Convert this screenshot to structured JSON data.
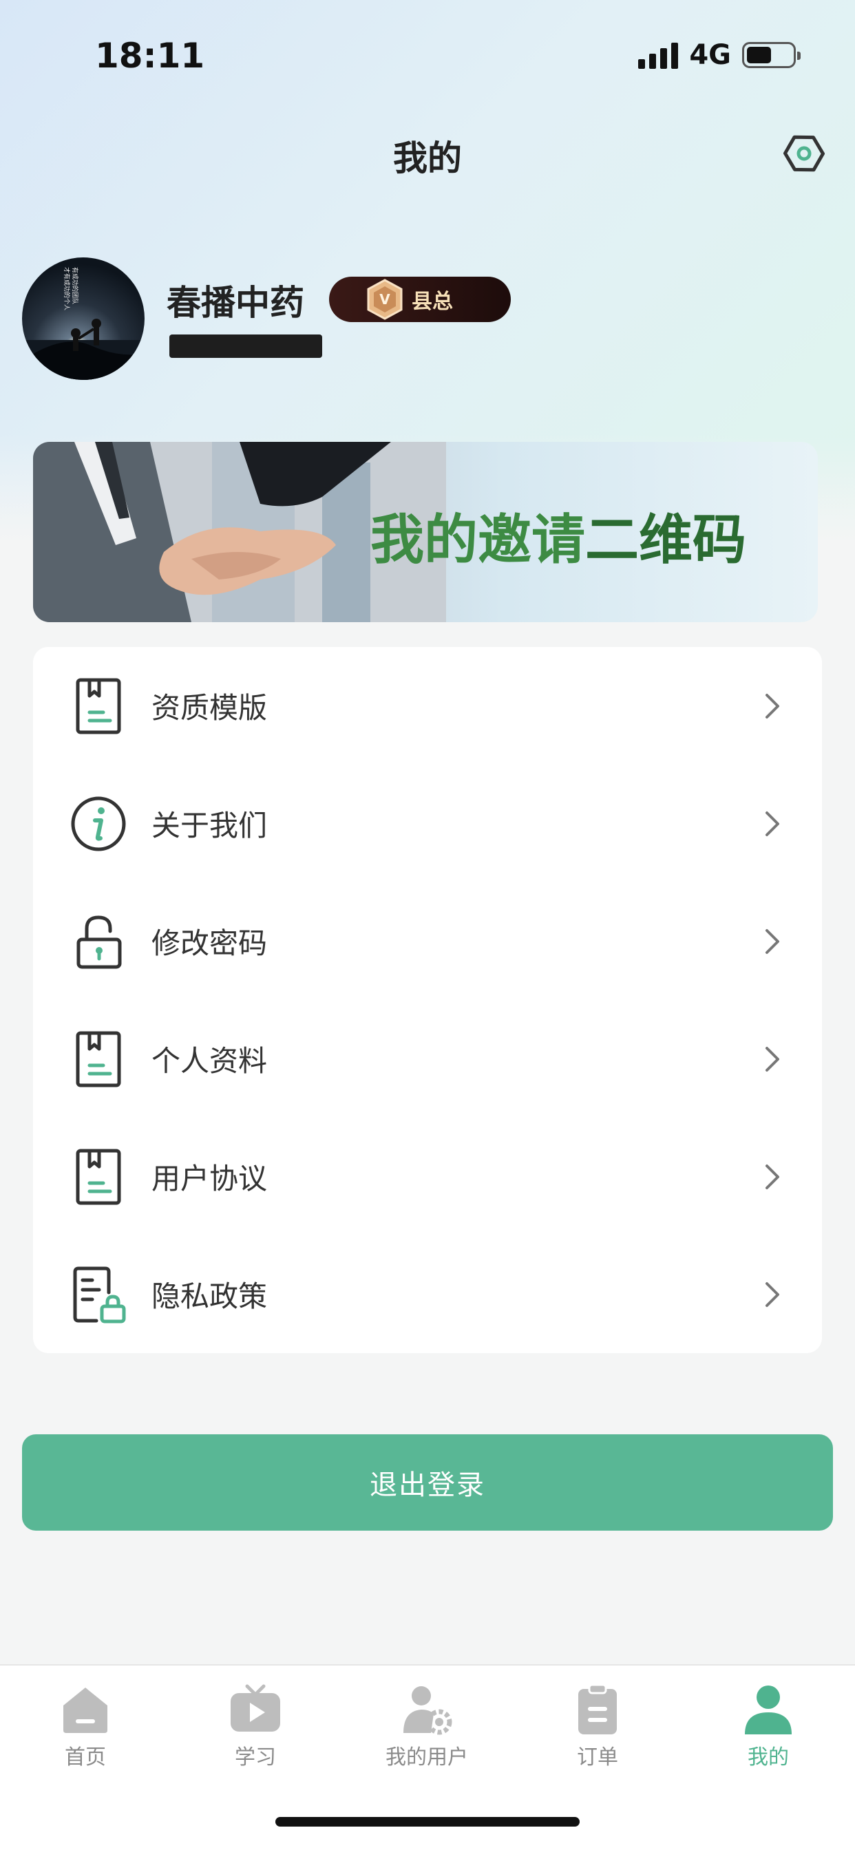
{
  "status_bar": {
    "time": "18:11",
    "network": "4G",
    "battery_level": 0.55
  },
  "header": {
    "title": "我的",
    "settings_icon": "hexagon-gear-icon"
  },
  "profile": {
    "name": "春播中药",
    "badge": {
      "label": "县总",
      "icon": "medal-v-icon"
    },
    "phone_masked": true
  },
  "invite_banner": {
    "text_part1": "我的邀请",
    "text_part2": "二维码"
  },
  "menu": {
    "items": [
      {
        "label": "资质模版",
        "icon": "bookmark-document-icon"
      },
      {
        "label": "关于我们",
        "icon": "info-icon"
      },
      {
        "label": "修改密码",
        "icon": "unlock-icon"
      },
      {
        "label": "个人资料",
        "icon": "bookmark-document-icon"
      },
      {
        "label": "用户协议",
        "icon": "bookmark-document-icon"
      },
      {
        "label": "隐私政策",
        "icon": "document-lock-icon"
      }
    ]
  },
  "logout": {
    "label": "退出登录"
  },
  "tabbar": {
    "tabs": [
      {
        "label": "首页",
        "icon": "home-icon",
        "active": false
      },
      {
        "label": "学习",
        "icon": "tv-play-icon",
        "active": false
      },
      {
        "label": "我的用户",
        "icon": "user-gear-icon",
        "active": false
      },
      {
        "label": "订单",
        "icon": "clipboard-icon",
        "active": false
      },
      {
        "label": "我的",
        "icon": "person-icon",
        "active": true
      }
    ]
  },
  "colors": {
    "accent": "#59b795",
    "badge_bg": "#2a1210",
    "badge_text": "#f6e0b8",
    "banner_text": "#3d8b43"
  }
}
